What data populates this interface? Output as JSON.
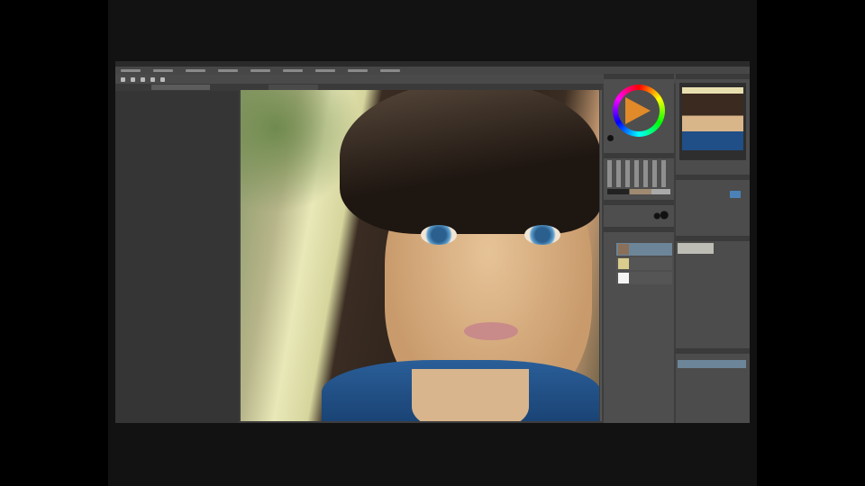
{
  "app": {
    "name": "painting-app",
    "video_letterbox": true
  },
  "colors": {
    "ui_background": "#3d3d3d",
    "panel": "#4e4e4e",
    "selected_layer": "#6d8598",
    "current_color": "#e08a2a",
    "canvas_hair": "#2a2019",
    "canvas_skin": "#d7b086",
    "canvas_jacket": "#1f4f86"
  },
  "icons": [
    "color-wheel-icon",
    "navigator-icon",
    "brush-icon",
    "eraser-icon",
    "pen-icon",
    "layer-icon",
    "eye-icon"
  ],
  "layers": [
    {
      "thumbnail": "portrait",
      "selected": true
    },
    {
      "thumbnail": "background",
      "selected": false
    },
    {
      "thumbnail": "paper",
      "selected": false
    }
  ],
  "brush_sizes": 5
}
